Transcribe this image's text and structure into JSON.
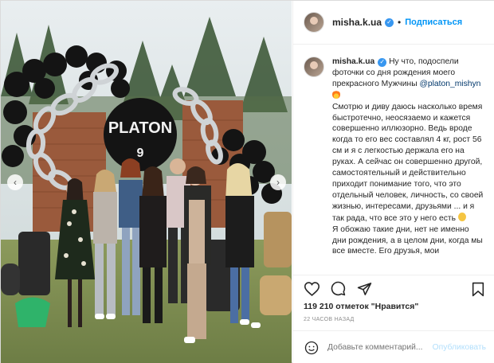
{
  "post": {
    "username": "misha.k.ua",
    "follow_label": "Подписаться",
    "separator": "•"
  },
  "photo": {
    "sign_text": "PLATON",
    "sign_number": "9"
  },
  "caption": {
    "username": "misha.k.ua",
    "line1": " Ну что, подоспели фоточки со дня рождения моего прекрасного Мужчины ",
    "mention": "@platon_mishyn",
    "line2": "Смотрю и диву даюсь насколько время быстротечно, неосязаемо и кажется совершенно иллюзорно. Ведь вроде когда то его вес составлял 4 кг, рост 56 см и я с легкостью держала его на руках. А сейчас он совершенно другой, самостоятельный и действительно приходит понимание того, что это отдельный человек, личность, со своей жизнью, интересами, друзьями ... и я так рада, что все это у него есть ",
    "line3": "Я обожаю такие дни, нет не именно дни рождения, а в целом дни, когда мы все вместе. Его друзья, мои"
  },
  "stats": {
    "likes": "119 210 отметок \"Нравится\"",
    "time": "22 ЧАСОВ НАЗАД"
  },
  "comment": {
    "placeholder": "Добавьте комментарий...",
    "post_label": "Опубликовать"
  },
  "icons": {
    "like": "heart-icon",
    "comment": "comment-icon",
    "share": "share-icon",
    "save": "bookmark-icon",
    "emoji": "smiley-icon",
    "verified": "verified-badge-icon",
    "prev": "chevron-left-icon",
    "next": "chevron-right-icon"
  },
  "colors": {
    "accent": "#0095f6",
    "verified": "#3897f0",
    "mention": "#00376b",
    "muted": "#8e8e8e",
    "post_disabled": "#b2dffc"
  }
}
